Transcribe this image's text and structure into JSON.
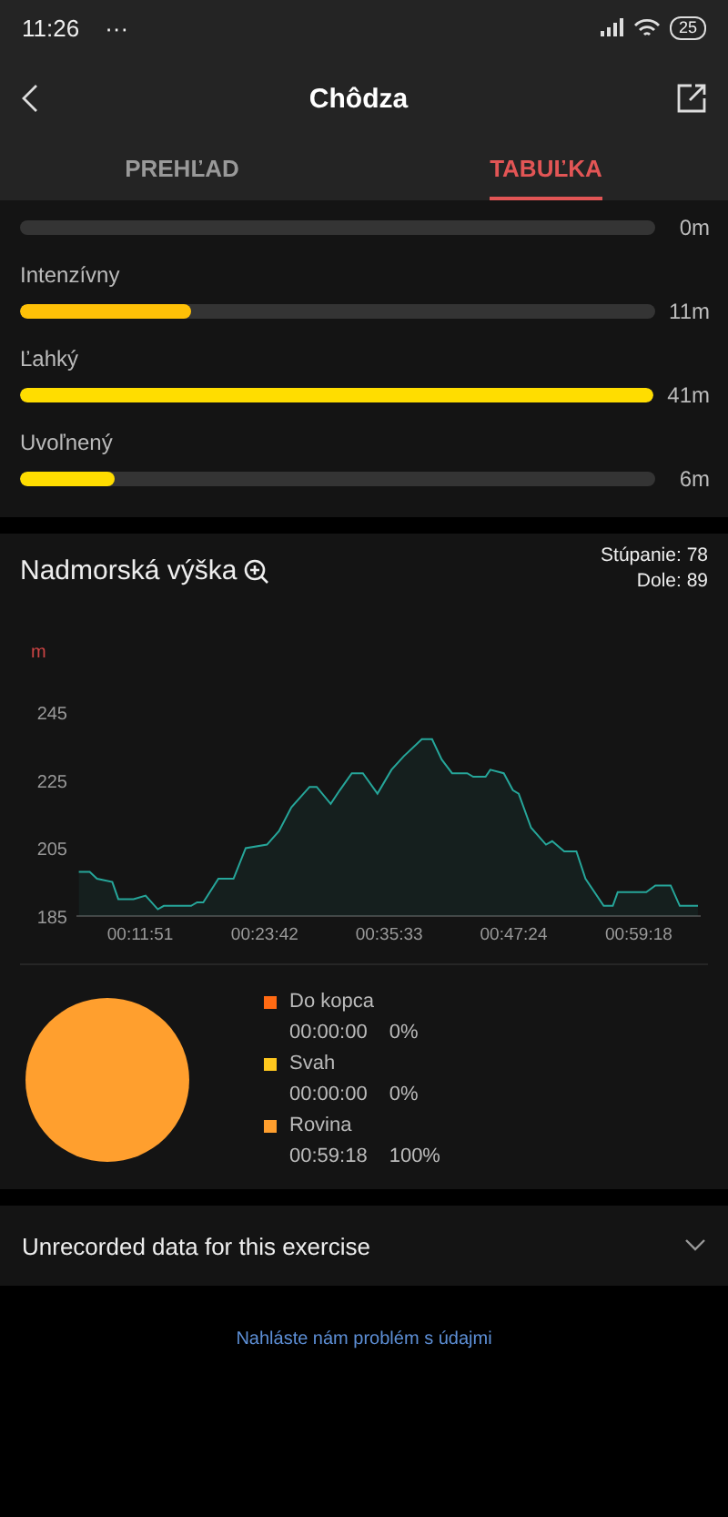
{
  "status_bar": {
    "time": "11:26",
    "dots": "···",
    "battery": "25"
  },
  "header": {
    "title": "Chôdza"
  },
  "tabs": [
    {
      "label": "PREHĽAD",
      "selected": false
    },
    {
      "label": "TABUĽKA",
      "selected": true
    }
  ],
  "zones": [
    {
      "value": "0m"
    },
    {
      "label": "Intenzívny",
      "value": "11m",
      "level": 0.27,
      "color": "#ffc107"
    },
    {
      "label": "Ľahký",
      "value": "41m",
      "level": 1,
      "color": "#ffdd00"
    },
    {
      "label": "Uvoľnený",
      "value": "6m",
      "level": 0.15,
      "color": "#ffdd00"
    }
  ],
  "elevation": {
    "title": "Nadmorská výška",
    "ascent": "Stúpanie: 78",
    "descent": "Dole: 89",
    "unit": "m",
    "chart_data": {
      "type": "area",
      "xlim": [
        347,
        3912
      ],
      "ylim": [
        185,
        245
      ],
      "yticks": [
        185,
        205,
        225,
        245
      ],
      "xticks": [
        {
          "value": 711,
          "label": "00:11:51"
        },
        {
          "value": 1422,
          "label": "00:23:42"
        },
        {
          "value": 2133,
          "label": "00:35:33"
        },
        {
          "value": 2844,
          "label": "00:47:24"
        },
        {
          "value": 3558,
          "label": "00:59:18"
        }
      ],
      "x": [
        361,
        423,
        464,
        552,
        586,
        673,
        742,
        812,
        846,
        1002,
        1036,
        1071,
        1158,
        1244,
        1314,
        1435,
        1504,
        1574,
        1678,
        1719,
        1799,
        1851,
        1920,
        1983,
        2066,
        2146,
        2216,
        2320,
        2378,
        2433,
        2492,
        2579,
        2613,
        2683,
        2710,
        2787,
        2839,
        2873,
        2943,
        3029,
        3064,
        3133,
        3202,
        3254,
        3358,
        3410,
        3438,
        3601,
        3653,
        3740,
        3792,
        3896
      ],
      "series": [
        {
          "color": "#26a69a",
          "values": [
            198,
            198,
            196,
            195,
            190,
            190,
            191,
            187,
            188,
            188,
            189,
            189,
            196,
            196,
            205,
            206,
            210,
            217,
            223,
            223,
            218,
            222,
            227,
            227,
            221,
            228,
            232,
            237,
            237,
            231,
            227,
            227,
            226,
            226,
            228,
            227,
            222,
            221,
            211,
            206,
            207,
            204,
            204,
            196,
            188,
            188,
            192,
            192,
            194,
            194,
            188,
            188
          ]
        }
      ]
    }
  },
  "terrain": {
    "chart_data": {
      "type": "pie",
      "categories": [
        "Do kopca",
        "Svah",
        "Rovina"
      ],
      "values": [
        0,
        0,
        100
      ]
    },
    "legend": [
      {
        "time": "00:00:00",
        "percent": "0%",
        "color": "#ff6a13"
      },
      {
        "time": "00:00:00",
        "percent": "0%",
        "color": "#ffc81e"
      },
      {
        "time": "00:59:18",
        "percent": "100%",
        "color": "#ff9f2e"
      }
    ]
  },
  "unrecorded": {
    "label": "Unrecorded data for this exercise",
    "expanded": false
  },
  "report_link": "Nahláste nám problém s údajmi"
}
